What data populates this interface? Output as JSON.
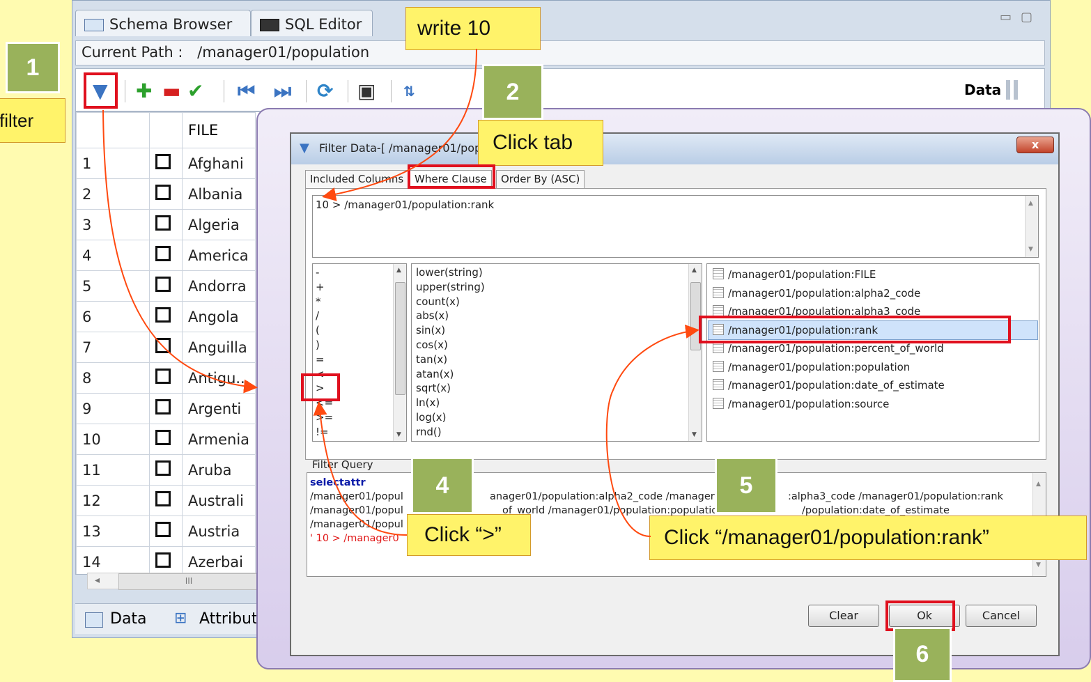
{
  "app": {
    "tabs": [
      "Schema Browser",
      "SQL Editor"
    ],
    "path_label": "Current Path :",
    "path_value": "/manager01/population",
    "data_label": "Data",
    "grid": {
      "header": "FILE",
      "rows": [
        {
          "n": "1",
          "v": "Afghani"
        },
        {
          "n": "2",
          "v": "Albania"
        },
        {
          "n": "3",
          "v": "Algeria"
        },
        {
          "n": "4",
          "v": "America"
        },
        {
          "n": "5",
          "v": "Andorra"
        },
        {
          "n": "6",
          "v": "Angola"
        },
        {
          "n": "7",
          "v": "Anguilla"
        },
        {
          "n": "8",
          "v": "Antigu..."
        },
        {
          "n": "9",
          "v": "Argenti"
        },
        {
          "n": "10",
          "v": "Armenia"
        },
        {
          "n": "11",
          "v": "Aruba"
        },
        {
          "n": "12",
          "v": "Australi"
        },
        {
          "n": "13",
          "v": "Austria"
        },
        {
          "n": "14",
          "v": "Azerbai"
        }
      ]
    },
    "scroll_mark": "III",
    "bottom_tabs": [
      "Data",
      "Attribut"
    ]
  },
  "dialog": {
    "title": "Filter Data-[ /manager01/popu",
    "close": "x",
    "tabs": [
      "Included Columns",
      "Where Clause",
      "Order By (ASC)"
    ],
    "where_text": "10 > /manager01/population:rank",
    "operators": [
      "-",
      "+",
      "*",
      "/",
      "(",
      ")",
      "=",
      "<",
      ">",
      "<=",
      ">=",
      "!="
    ],
    "functions": [
      "lower(string)",
      "upper(string)",
      "count(x)",
      "abs(x)",
      "sin(x)",
      "cos(x)",
      "tan(x)",
      "atan(x)",
      "sqrt(x)",
      "ln(x)",
      "log(x)",
      "rnd()"
    ],
    "attributes": [
      "/manager01/population:FILE",
      "/manager01/population:alpha2_code",
      "/manager01/population:alpha3_code",
      "/manager01/population:rank",
      "/manager01/population:percent_of_world",
      "/manager01/population:population",
      "/manager01/population:date_of_estimate",
      "/manager01/population:source"
    ],
    "filter_query_label": "Filter Query",
    "query_lines": [
      "selectattr",
      "/manager01/popul",
      "anager01/population:alpha2_code /manager0",
      ":alpha3_code /manager01/population:rank",
      "/manager01/popul",
      "of_world /manager01/population:population",
      "/population:date_of_estimate",
      "/manager01/popul",
      "' 10 > /manager0"
    ],
    "buttons": {
      "clear": "Clear",
      "ok": "Ok",
      "cancel": "Cancel"
    }
  },
  "annotations": {
    "step1": "1",
    "filter": "filter",
    "write10": "write 10",
    "step2": "2",
    "click_tab": "Click tab",
    "step4": "4",
    "click_gt": "Click “>”",
    "step5": "5",
    "click_rank": "Click “/manager01/population:rank”",
    "step6": "6"
  }
}
